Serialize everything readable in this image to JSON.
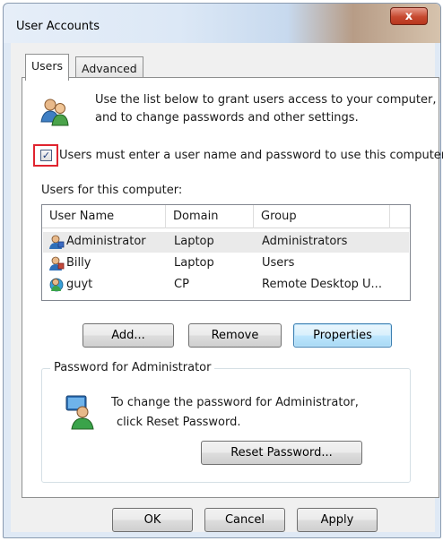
{
  "window": {
    "title": "User Accounts",
    "close_glyph": "x"
  },
  "tabs": [
    {
      "label": "Users",
      "active": true
    },
    {
      "label": "Advanced",
      "active": false
    }
  ],
  "intro": {
    "line1": "Use the list below to grant users access to your computer,",
    "line2": "and to change passwords and other settings."
  },
  "require_login": {
    "checked": true,
    "label": "Users must enter a user name and password to use this computer"
  },
  "users_section": {
    "label": "Users for this computer:",
    "columns": [
      "User Name",
      "Domain",
      "Group"
    ],
    "rows": [
      {
        "user": "Administrator",
        "domain": "Laptop",
        "group": "Administrators",
        "icon": "admin-user-icon",
        "selected": true
      },
      {
        "user": "Billy",
        "domain": "Laptop",
        "group": "Users",
        "icon": "standard-user-icon",
        "selected": false
      },
      {
        "user": "guyt",
        "domain": "CP",
        "group": "Remote Desktop U...",
        "icon": "domain-user-icon",
        "selected": false
      }
    ]
  },
  "user_buttons": {
    "add": "Add...",
    "remove": "Remove",
    "properties": "Properties"
  },
  "password_group": {
    "title": "Password for Administrator",
    "line1": "To change the password for Administrator,",
    "line2": "click Reset Password.",
    "reset_button": "Reset Password..."
  },
  "dialog_buttons": {
    "ok": "OK",
    "cancel": "Cancel",
    "apply": "Apply"
  },
  "colors": {
    "highlight_box": "#e0242f",
    "default_button_border": "#3c7fb1"
  }
}
